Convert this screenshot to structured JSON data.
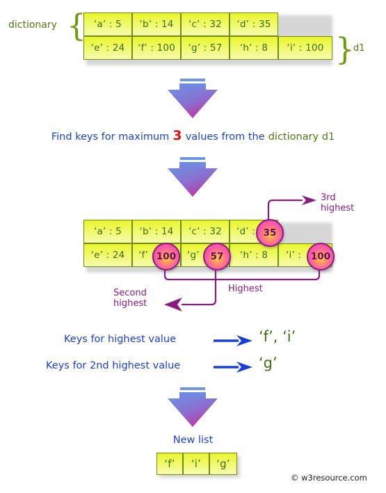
{
  "meta": {
    "title": "Find keys for maximum 3 values from a dictionary",
    "footer": "© w3resource.com"
  },
  "colors": {
    "cell_fill_top": "#e8f52a",
    "cell_fill_bottom": "#f6fbb0",
    "cell_border": "#6f8c10",
    "cell_text": "#3f6b0d",
    "blue_text": "#1a3fd8",
    "green_text": "#4f7a11",
    "red_accent": "#e11010",
    "purple_accent": "#8a1a82",
    "arrow_gradient_start": "#6f8fe0",
    "arrow_gradient_end": "#c2239c",
    "circle_border": "#8a1a82"
  },
  "dictionary_block": {
    "label": "dictionary",
    "brace_open": "{",
    "brace_close": "}",
    "var_name": "d1",
    "row1": [
      {
        "key": "‘a’",
        "sep": ":",
        "value": "5",
        "text": "‘a’ : 5"
      },
      {
        "key": "‘b’",
        "sep": ":",
        "value": "14",
        "text": "‘b’ : 14"
      },
      {
        "key": "‘c’",
        "sep": ":",
        "value": "32",
        "text": "‘c’ : 32"
      },
      {
        "key": "‘d’",
        "sep": ":",
        "value": "35",
        "text": "‘d’ : 35"
      }
    ],
    "row2": [
      {
        "key": "‘e’",
        "sep": ":",
        "value": "24",
        "text": "‘e’ : 24"
      },
      {
        "key": "‘f’",
        "sep": ":",
        "value": "100",
        "text": "‘f’ : 100"
      },
      {
        "key": "‘g’",
        "sep": ":",
        "value": "57",
        "text": "‘g’ : 57"
      },
      {
        "key": "‘h’",
        "sep": ":",
        "value": "8",
        "text": "‘h’ : 8"
      },
      {
        "key": "‘i’",
        "sep": ":",
        "value": "100",
        "text": "‘i’ : 100"
      }
    ]
  },
  "instruction": {
    "part1": "Find keys for maximum",
    "count": "3",
    "part2": "values from the",
    "part3": "dictionary d1"
  },
  "highlight_block": {
    "row1": [
      {
        "text": "‘a’ : 5",
        "prefix": "‘a’ : 5",
        "circled": false,
        "circle_value": ""
      },
      {
        "text": "‘b’ : 14",
        "prefix": "‘b’ : 14",
        "circled": false,
        "circle_value": ""
      },
      {
        "text": "‘c’ : 32",
        "prefix": "‘c’ : 32",
        "circled": false,
        "circle_value": ""
      },
      {
        "text": "‘d’ : 35",
        "prefix": "‘d’ :",
        "circled": true,
        "circle_value": "35"
      }
    ],
    "row2": [
      {
        "text": "‘e’ : 24",
        "prefix": "‘e’ : 24",
        "circled": false,
        "circle_value": ""
      },
      {
        "text": "‘f’ : 100",
        "prefix": "‘f’ :",
        "circled": true,
        "circle_value": "100"
      },
      {
        "text": "‘g’ : 57",
        "prefix": "‘g’ :",
        "circled": true,
        "circle_value": "57"
      },
      {
        "text": "‘h’ : 8",
        "prefix": "‘h’ : 8",
        "circled": false,
        "circle_value": ""
      },
      {
        "text": "‘i’ : 100",
        "prefix": "‘i’ :",
        "circled": true,
        "circle_value": "100"
      }
    ],
    "annotations": {
      "third_highest_line1": "3rd",
      "third_highest_line2": "highest",
      "highest": "Highest",
      "second_highest_line1": "Second",
      "second_highest_line2": "highest"
    }
  },
  "results": [
    {
      "label": "Keys for highest value",
      "value": "‘f’, ‘i’"
    },
    {
      "label": "Keys for 2nd highest value",
      "value": "‘g’"
    }
  ],
  "new_list": {
    "label": "New list",
    "items": [
      "‘f’",
      "‘i’",
      "‘g’"
    ]
  }
}
